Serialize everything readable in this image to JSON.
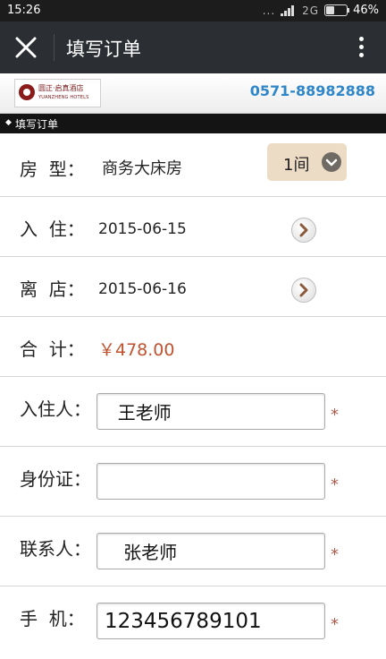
{
  "status_bar": {
    "time": "15:26",
    "dots": "...",
    "network": "2G",
    "battery": "46%"
  },
  "nav": {
    "title": "填写订单",
    "close_icon": "close-icon",
    "more_icon": "more-vertical-icon"
  },
  "hotel": {
    "logo_name_cn": "圆正·启真酒店",
    "logo_name_en": "YUANZHENG HOTELS",
    "phone": "0571-88982888"
  },
  "section": {
    "title": "填写订单"
  },
  "form": {
    "room_type": {
      "label": "房  型：",
      "value": "商务大床房",
      "count": "1间"
    },
    "check_in": {
      "label": "入  住：",
      "value": "2015-06-15"
    },
    "check_out": {
      "label": "离  店：",
      "value": "2015-06-16"
    },
    "total": {
      "label": "合  计：",
      "value": "￥478.00"
    },
    "guest": {
      "label": "入住人：",
      "value": "  王老师",
      "required": "*"
    },
    "id_card": {
      "label": "身份证：",
      "value": "",
      "required": "*"
    },
    "contact": {
      "label": "联系人：",
      "value": "   张老师",
      "required": "*"
    },
    "mobile": {
      "label": "手  机：",
      "value": "123456789101",
      "required": "*"
    }
  },
  "colors": {
    "nav_bg": "#2b2e33",
    "phone": "#2f86c9",
    "price": "#c0522f",
    "select_bg": "#ecdcc6",
    "required_star": "#b05a4a"
  }
}
